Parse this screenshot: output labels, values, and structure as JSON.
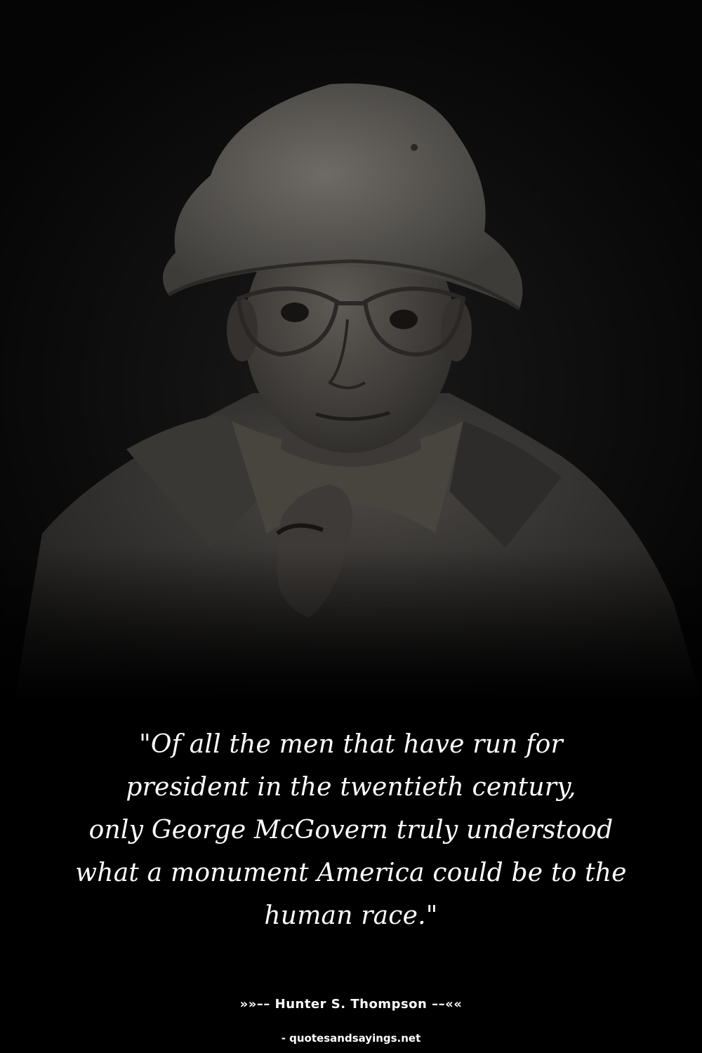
{
  "quote": {
    "lines": [
      "\"Of all the men that have run for",
      "president in the twentieth century,",
      "only George McGovern truly understood",
      "what a monument America could be to the",
      "human race.\""
    ]
  },
  "author": "»»–– Hunter S. Thompson ––««",
  "source": "- quotesandsayings.net",
  "colors": {
    "background": "#000000",
    "text": "#ffffff"
  }
}
